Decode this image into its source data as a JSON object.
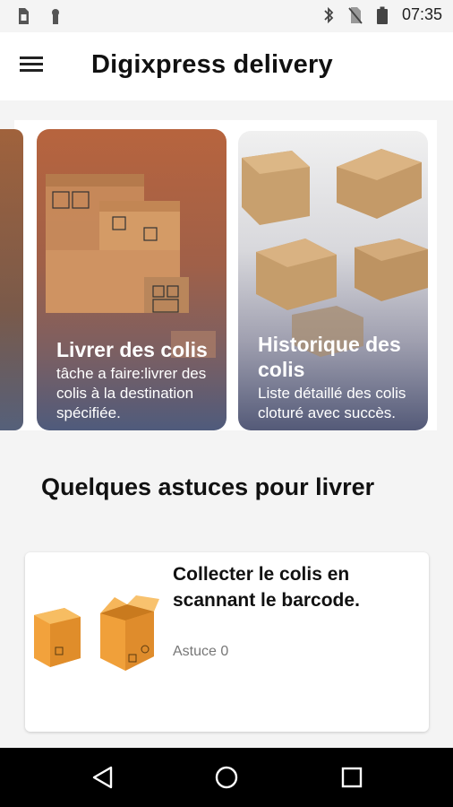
{
  "status_bar": {
    "time": "07:35",
    "icons": [
      "sim-card-icon",
      "lock-icon",
      "bluetooth-icon",
      "no-sim-icon",
      "battery-icon"
    ]
  },
  "app_bar": {
    "title": "Digixpress delivery",
    "menu_icon": "menu-icon"
  },
  "carousel": {
    "cards": [
      {
        "title": "Livrer des colis",
        "description": "tâche a faire:livrer des colis à la destination spécifiée."
      },
      {
        "title": "Historique des colis",
        "description": "Liste détaillé des colis cloturé avec succès."
      }
    ]
  },
  "tips": {
    "heading": "Quelques astuces pour livrer",
    "items": [
      {
        "title": "Collecter le colis en scannant le barcode.",
        "subtitle": "Astuce 0"
      }
    ]
  },
  "nav_bar": {
    "icons": [
      "back-icon",
      "home-icon",
      "recents-icon"
    ]
  },
  "colors": {
    "app_bar_bg": "#ffffff",
    "page_bg": "#f4f4f4",
    "nav_bar_bg": "#000000"
  }
}
